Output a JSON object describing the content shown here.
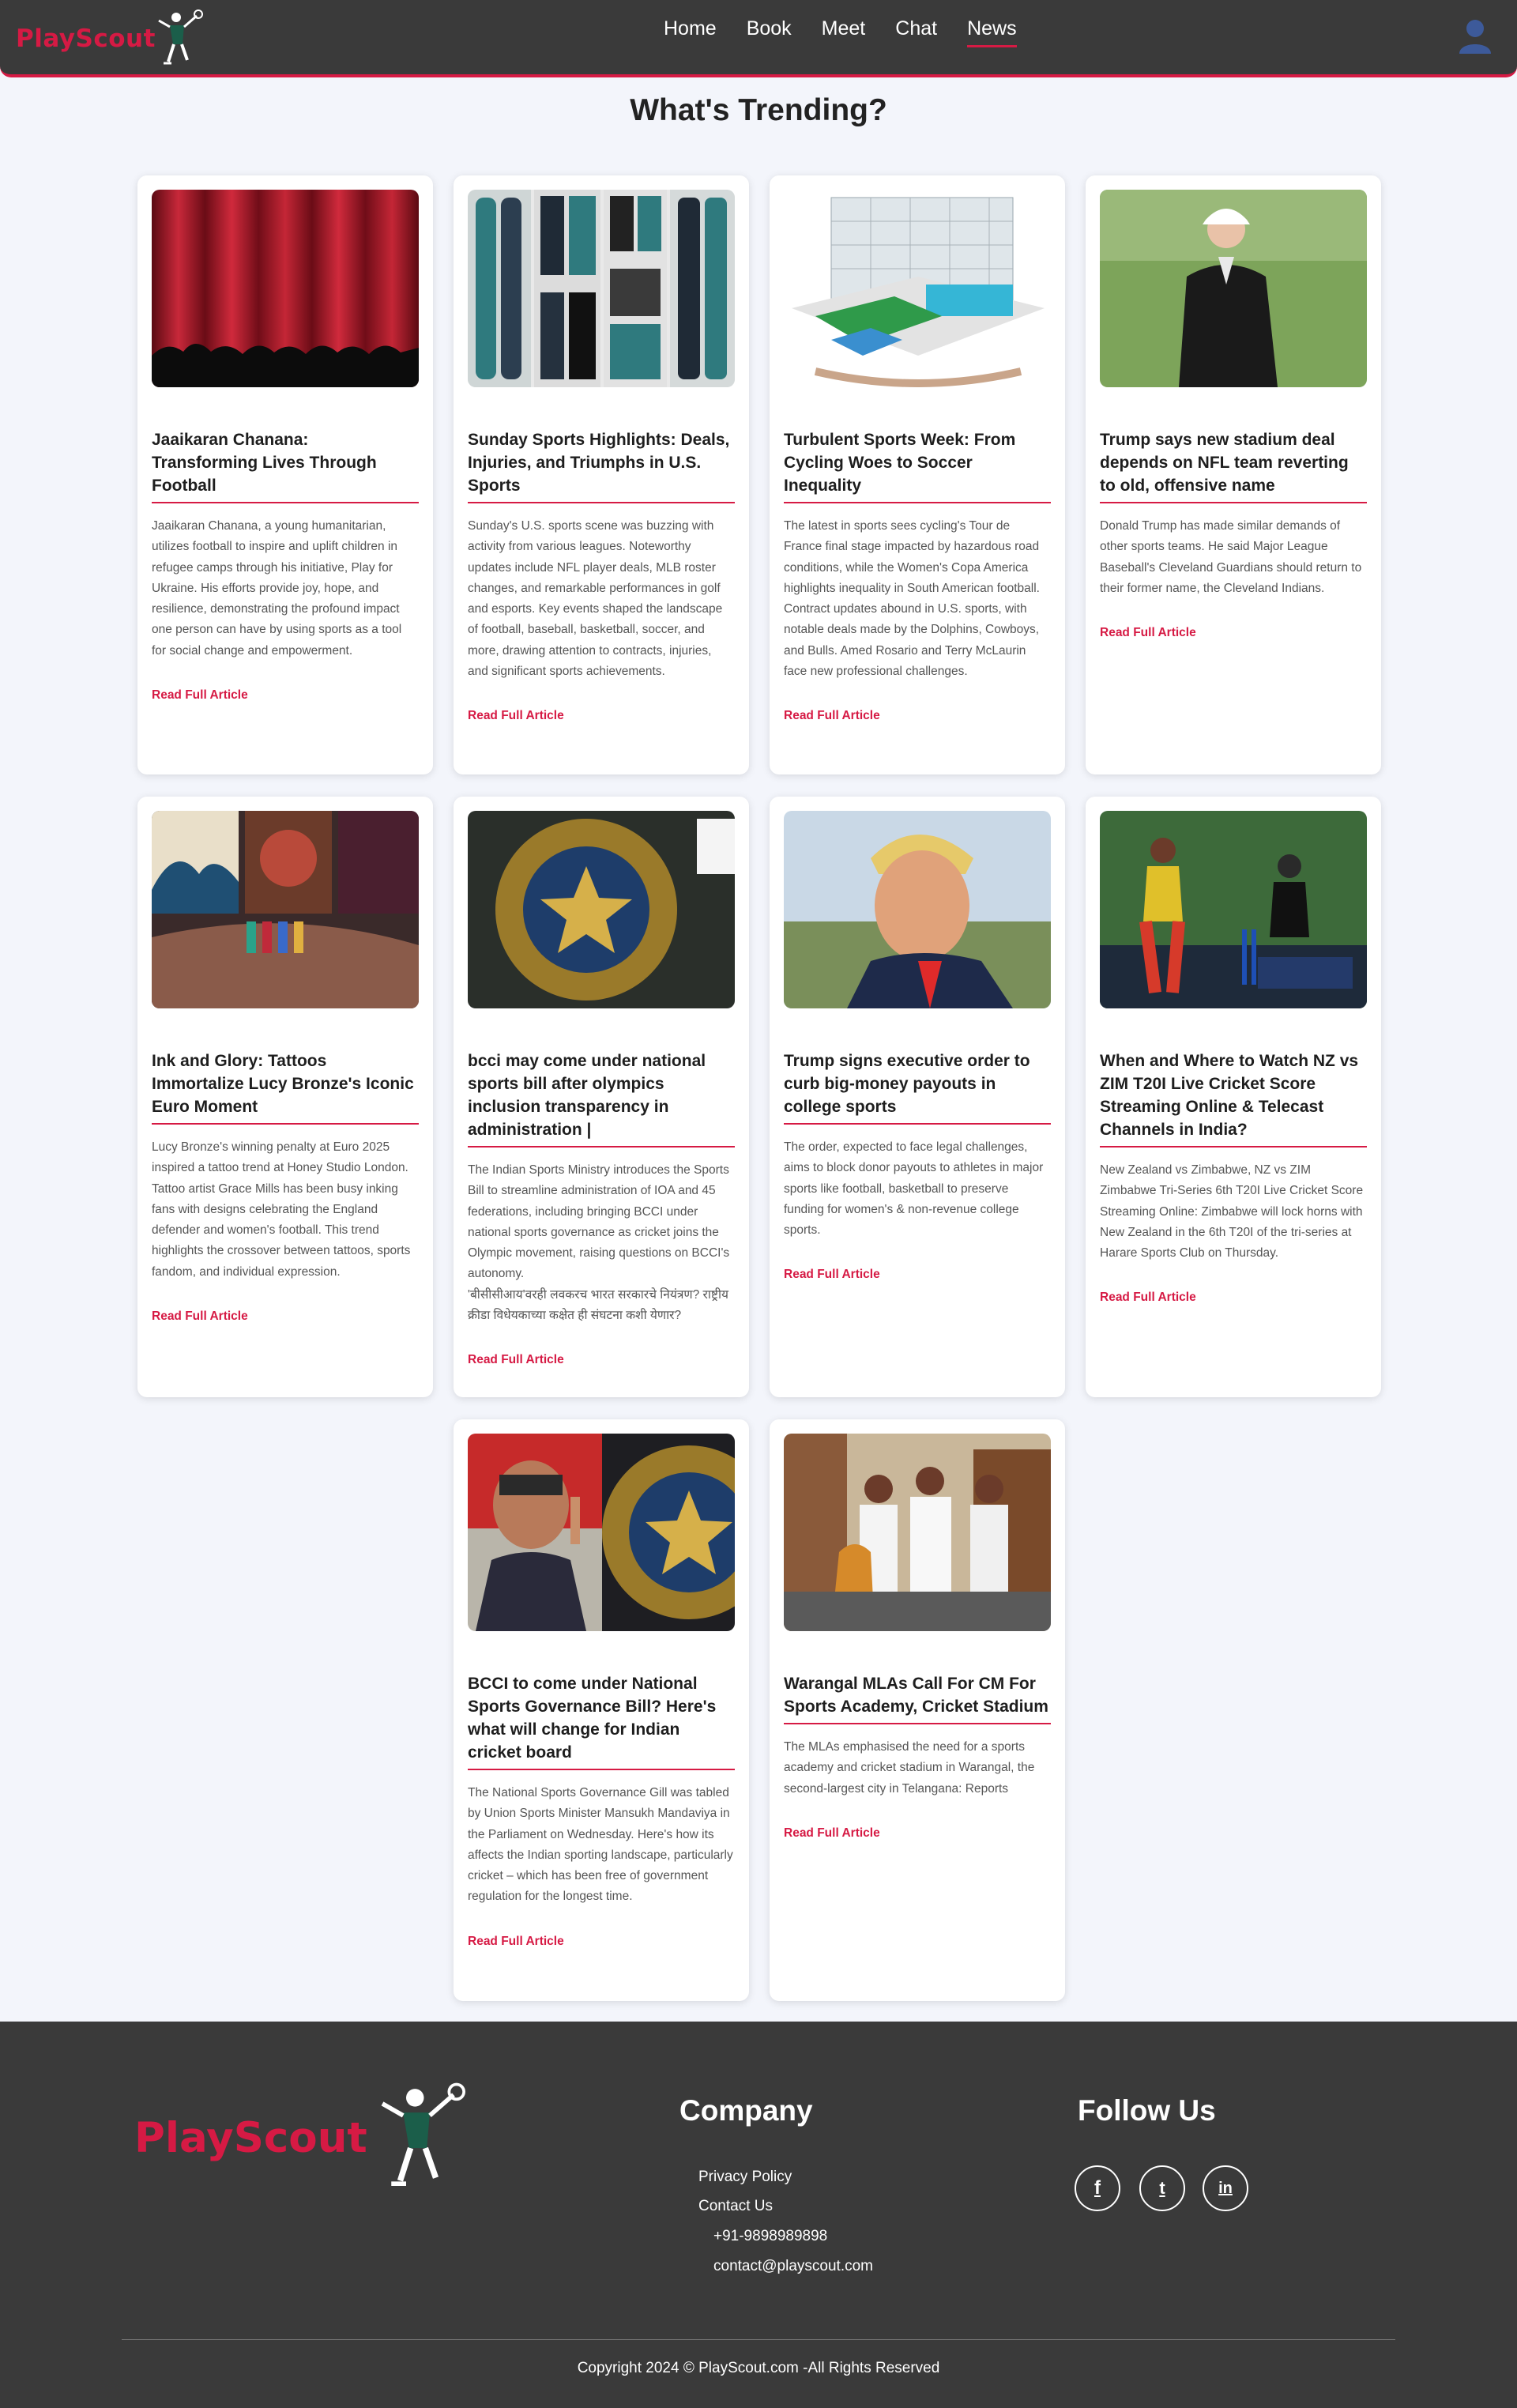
{
  "header": {
    "logo_text": "PlayScout",
    "nav": [
      {
        "label": "Home"
      },
      {
        "label": "Book"
      },
      {
        "label": "Meet"
      },
      {
        "label": "Chat"
      },
      {
        "label": "News",
        "active": true
      }
    ],
    "user_icon": "user-icon"
  },
  "page": {
    "title": "What's Trending?"
  },
  "articles": [
    {
      "title": "Jaaikaran Chanana: Transforming Lives Through Football",
      "description": "Jaaikaran Chanana, a young humanitarian, utilizes football to inspire and uplift children in refugee camps through his initiative, Play for Ukraine. His efforts provide joy, hope, and resilience, demonstrating the profound impact one person can have by using sports as a tool for social change and empowerment.",
      "link": "Read Full Article",
      "image": "theater-curtain-image"
    },
    {
      "title": "Sunday Sports Highlights: Deals, Injuries, and Triumphs in U.S. Sports",
      "description": "Sunday's U.S. sports scene was buzzing with activity from various leagues. Noteworthy updates include NFL player deals, MLB roster changes, and remarkable performances in golf and esports. Key events shaped the landscape of football, baseball, basketball, soccer, and more, drawing attention to contracts, injuries, and significant sports achievements.",
      "link": "Read Full Article",
      "image": "sportswear-collage-image"
    },
    {
      "title": "Turbulent Sports Week: From Cycling Woes to Soccer Inequality",
      "description": "The latest in sports sees cycling's Tour de France final stage impacted by hazardous road conditions, while the Women's Copa America highlights inequality in South American football. Contract updates abound in U.S. sports, with notable deals made by the Dolphins, Cowboys, and Bulls. Amed Rosario and Terry McLaurin face new professional challenges.",
      "link": "Read Full Article",
      "image": "sports-complex-image"
    },
    {
      "title": "Trump says new stadium deal depends on NFL team reverting to old, offensive name",
      "description": "Donald Trump has made similar demands of other sports teams. He said Major League Baseball's Cleveland Guardians should return to their former name, the Cleveland Indians.",
      "link": "Read Full Article",
      "image": "golf-course-image"
    },
    {
      "title": "Ink and Glory: Tattoos Immortalize Lucy Bronze's Iconic Euro Moment",
      "description": "Lucy Bronze's winning penalty at Euro 2025 inspired a tattoo trend at Honey Studio London. Tattoo artist Grace Mills has been busy inking fans with designs celebrating the England defender and women's football. This trend highlights the crossover between tattoos, sports fandom, and individual expression.",
      "link": "Read Full Article",
      "image": "tattoo-studio-image"
    },
    {
      "title": "bcci may come under national sports bill after olympics inclusion transparency in administration |",
      "description": "The Indian Sports Ministry introduces the Sports Bill to streamline administration of IOA and 45 federations, including bringing BCCI under national sports governance as cricket joins the Olympic movement, raising questions on BCCI's autonomy.",
      "description_extra": "'बीसीसीआय'वरही लवकरच भारत सरकारचे नियंत्रण? राष्ट्रीय क्रीडा विधेयकाच्या कक्षेत ही संघटना कशी येणार?",
      "link": "Read Full Article",
      "image": "bcci-logo-image"
    },
    {
      "title": "Trump signs executive order to curb big-money payouts in college sports",
      "description": "The order, expected to face legal challenges, aims to block donor payouts to athletes in major sports like football, basketball to preserve funding for women's & non-revenue college sports.",
      "link": "Read Full Article",
      "image": "portrait-image"
    },
    {
      "title": "When and Where to Watch NZ vs ZIM T20I Live Cricket Score Streaming Online & Telecast Channels in India?",
      "description": "New Zealand vs Zimbabwe, NZ vs ZIM Zimbabwe Tri-Series 6th T20I Live Cricket Score Streaming Online: Zimbabwe will lock horns with New Zealand in the 6th T20I of the tri-series at Harare Sports Club on Thursday.",
      "link": "Read Full Article",
      "image": "cricket-match-image"
    },
    {
      "title": "BCCI to come under National Sports Governance Bill? Here's what will change for Indian cricket board",
      "description": "The National Sports Governance Gill was tabled by Union Sports Minister Mansukh Mandaviya in the Parliament on Wednesday. Here's how its affects the Indian sporting landscape, particularly cricket – which has been free of government regulation for the longest time.",
      "link": "Read Full Article",
      "image": "minister-bcci-image"
    },
    {
      "title": "Warangal MLAs Call For CM For Sports Academy, Cricket Stadium",
      "description": "The MLAs emphasised the need for a sports academy and cricket stadium in Warangal, the second-largest city in Telangana: Reports",
      "link": "Read Full Article",
      "image": "meeting-group-image"
    }
  ],
  "footer": {
    "logo_text": "PlayScout",
    "company_heading": "Company",
    "links": [
      "Privacy Policy",
      "Contact Us"
    ],
    "phone": "+91-9898989898",
    "email": "contact@playscout.com",
    "follow_heading": "Follow Us",
    "social": [
      {
        "icon": "facebook-icon",
        "glyph": "f"
      },
      {
        "icon": "twitter-icon",
        "glyph": "t"
      },
      {
        "icon": "linkedin-icon",
        "glyph": "in"
      }
    ],
    "copyright": "Copyright 2024 © PlayScout.com -All Rights Reserved"
  },
  "colors": {
    "brand": "#d61a44",
    "header_bg": "#3a3a3a",
    "page_bg": "#f3f5fb"
  }
}
